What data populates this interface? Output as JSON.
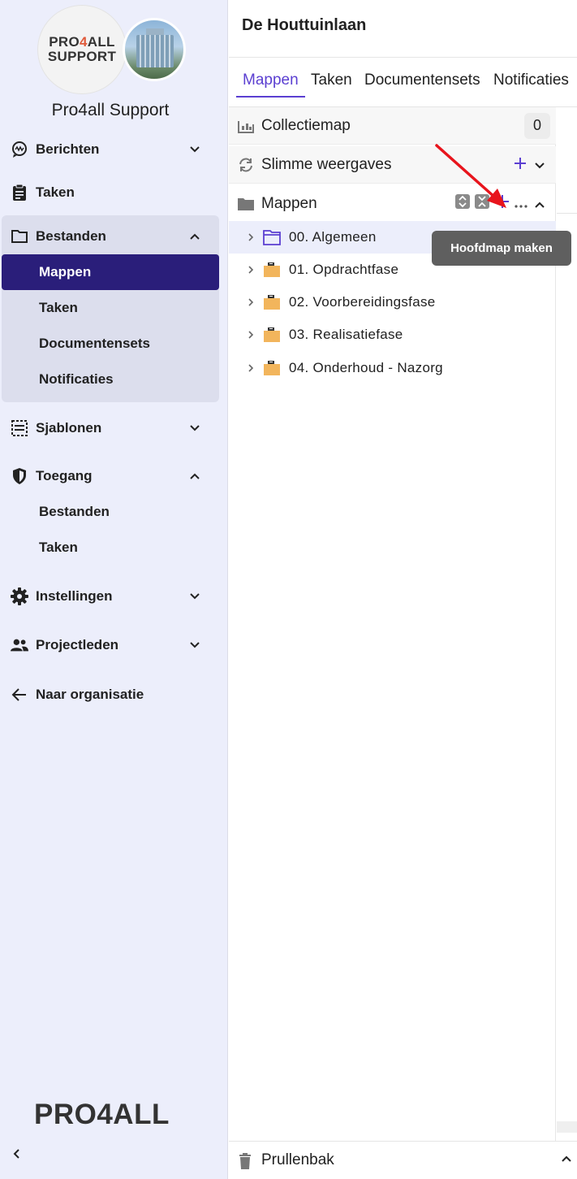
{
  "sidebar": {
    "org_logo_line1": "PRO4ALL",
    "org_logo_line2": "SUPPORT",
    "org_name": "Pro4all Support",
    "items": [
      {
        "label": "Berichten",
        "icon": "chat-icon"
      },
      {
        "label": "Taken",
        "icon": "clipboard-icon"
      },
      {
        "label": "Bestanden",
        "icon": "folder-icon"
      },
      {
        "label": "Sjablonen",
        "icon": "template-icon"
      },
      {
        "label": "Toegang",
        "icon": "shield-icon"
      },
      {
        "label": "Instellingen",
        "icon": "gear-icon"
      },
      {
        "label": "Projectleden",
        "icon": "people-icon"
      },
      {
        "label": "Naar organisatie",
        "icon": "arrow-left-icon"
      }
    ],
    "bestanden_sub": [
      "Mappen",
      "Taken",
      "Documentensets",
      "Notificaties"
    ],
    "toegang_sub": [
      "Bestanden",
      "Taken"
    ],
    "brand": "PRO4ALL"
  },
  "header": {
    "title": "De Houttuinlaan"
  },
  "tabs": [
    "Mappen",
    "Taken",
    "Documentensets",
    "Notificaties"
  ],
  "panel": {
    "collection_label": "Collectiemap",
    "collection_count": "0",
    "smart_views_label": "Slimme weergaves",
    "folders_label": "Mappen",
    "trash_label": "Prullenbak"
  },
  "folders": [
    "00. Algemeen",
    "01. Opdrachtfase",
    "02. Voorbereidingsfase",
    "03. Realisatiefase",
    "04. Onderhoud - Nazorg"
  ],
  "tooltip": "Hoofdmap maken",
  "colors": {
    "accent": "#5b3fd1",
    "active_nav": "#2a1e7a",
    "folder": "#f2b55c",
    "arrow": "#e8141c"
  }
}
